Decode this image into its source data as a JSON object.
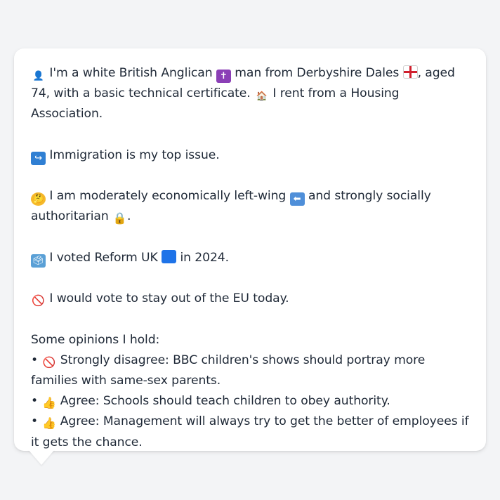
{
  "profile": {
    "line1": {
      "icon_person": "👤",
      "t1": " I'm a white British Anglican ",
      "icon_cross": "✝",
      "t2": " man from Derbyshire Dales ",
      "icon_flag": "",
      "t3": ", aged 74, with a basic technical certificate. ",
      "icon_house": "🏠",
      "t4": " I rent from a Housing Association."
    },
    "line2": {
      "icon": "↪",
      "text": " Immigration is my top issue."
    },
    "line3": {
      "icon_think": "🤔",
      "t1": " I am moderately economically left-wing ",
      "icon_left": "⬅",
      "t2": " and strongly socially authoritarian ",
      "icon_lock": "🔒",
      "t3": "."
    },
    "line4": {
      "icon_ballot": "🗳",
      "t1": " I voted Reform UK ",
      "icon_square": "",
      "t2": " in 2024."
    },
    "line5": {
      "icon": "🚫",
      "text": " I would vote to stay out of the EU today."
    },
    "opinions_heading": "Some opinions I hold:",
    "opinions": [
      {
        "bullet": "• ",
        "icon": "🚫",
        "text": " Strongly disagree: BBC children's shows should portray more families with same-sex parents."
      },
      {
        "bullet": "• ",
        "icon": "👍",
        "text": " Agree: Schools should teach children to obey authority."
      },
      {
        "bullet": "• ",
        "icon": "👍",
        "text": " Agree: Management will always try to get the better of employees if it gets the chance."
      }
    ]
  },
  "colors": {
    "background": "#f3f4f6",
    "card": "#ffffff",
    "text": "#1f2937"
  }
}
